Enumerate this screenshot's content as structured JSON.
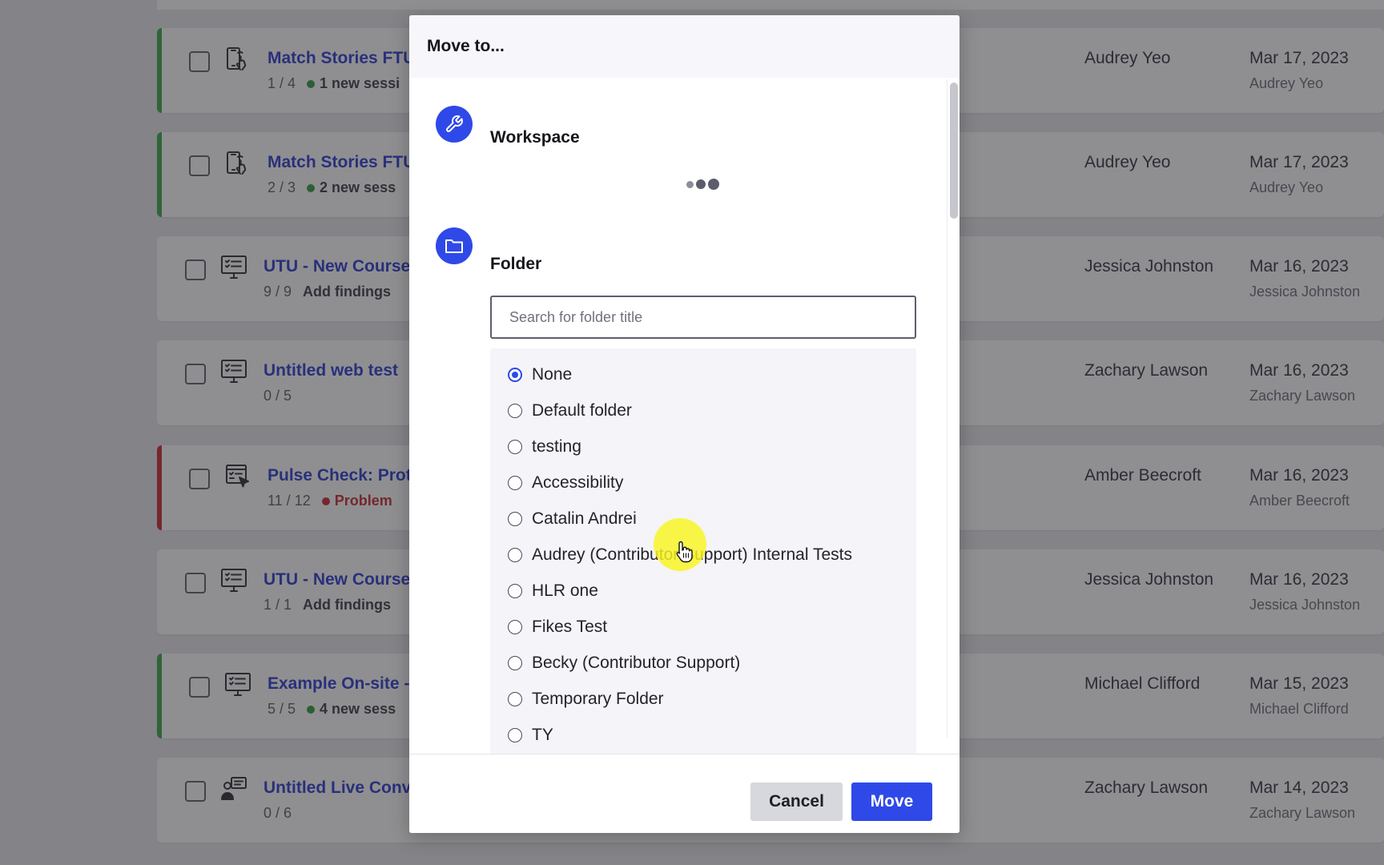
{
  "background_list": {
    "rows": [
      {
        "title": "Match Stories FTU",
        "progress": "1 / 4",
        "status": "1 new sessi",
        "status_color": "#2e9b3f",
        "owner": "Audrey Yeo",
        "date": "Mar 17, 2023",
        "by": "Audrey Yeo",
        "accent": "#3aa845",
        "icon": "mobile-tap-icon"
      },
      {
        "title": "Match Stories FTU",
        "progress": "2 / 3",
        "status": "2 new sess",
        "status_color": "#2e9b3f",
        "owner": "Audrey Yeo",
        "date": "Mar 17, 2023",
        "by": "Audrey Yeo",
        "accent": "#3aa845",
        "icon": "mobile-tap-icon"
      },
      {
        "title": "UTU - New Course",
        "progress": "9 / 9",
        "status": "Add findings",
        "status_color": "",
        "owner": "Jessica Johnston",
        "date": "Mar 16, 2023",
        "by": "Jessica Johnston",
        "accent": "",
        "icon": "desktop-checklist-icon"
      },
      {
        "title": "Untitled web test",
        "progress": "0 / 5",
        "status": "",
        "status_color": "",
        "owner": "Zachary Lawson",
        "date": "Mar 16, 2023",
        "by": "Zachary Lawson",
        "accent": "",
        "icon": "desktop-checklist-icon"
      },
      {
        "title": "Pulse Check: Prot",
        "progress": "11 / 12",
        "status": "Problem",
        "status_color": "#c8262e",
        "owner": "Amber Beecroft",
        "date": "Mar 16, 2023",
        "by": "Amber Beecroft",
        "accent": "#c8262e",
        "icon": "screen-click-icon"
      },
      {
        "title": "UTU - New Course",
        "progress": "1 / 1",
        "status": "Add findings",
        "status_color": "",
        "owner": "Jessica Johnston",
        "date": "Mar 16, 2023",
        "by": "Jessica Johnston",
        "accent": "",
        "icon": "desktop-checklist-icon"
      },
      {
        "title": "Example On-site -",
        "progress": "5 / 5",
        "status": "4 new sess",
        "status_color": "#2e9b3f",
        "owner": "Michael Clifford",
        "date": "Mar 15, 2023",
        "by": "Michael Clifford",
        "accent": "#3aa845",
        "icon": "desktop-checklist-icon"
      },
      {
        "title": "Untitled Live Conv",
        "progress": "0 / 6",
        "status": "",
        "status_color": "",
        "owner": "Zachary Lawson",
        "date": "Mar 14, 2023",
        "by": "Zachary Lawson",
        "accent": "",
        "icon": "live-conversation-icon"
      }
    ]
  },
  "modal": {
    "title": "Move to...",
    "workspace_label": "Workspace",
    "folder_label": "Folder",
    "search_placeholder": "Search for folder title",
    "selected_folder": "None",
    "folders": [
      "None",
      "Default folder",
      "testing",
      "Accessibility",
      "Catalin Andrei",
      "Audrey (Contributor Support) Internal Tests",
      "HLR one",
      "Fikes Test",
      "Becky (Contributor Support)",
      "Temporary Folder",
      "TY"
    ],
    "cancel_label": "Cancel",
    "move_label": "Move"
  },
  "colors": {
    "accent": "#2f49e8",
    "link": "#2a3ad0",
    "success": "#3aa845",
    "danger": "#c8262e"
  }
}
